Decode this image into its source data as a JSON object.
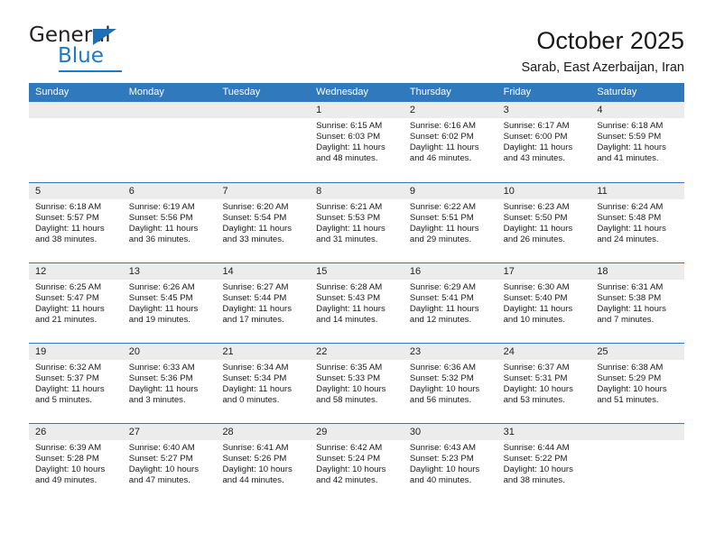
{
  "brand": {
    "name_part1": "General",
    "name_part2": "Blue"
  },
  "header": {
    "title": "October 2025",
    "subtitle": "Sarab, East Azerbaijan, Iran"
  },
  "weekdays": [
    "Sunday",
    "Monday",
    "Tuesday",
    "Wednesday",
    "Thursday",
    "Friday",
    "Saturday"
  ],
  "colors": {
    "header_band": "#3079bd",
    "day_band": "#ececec",
    "brand_blue": "#1f7ac4",
    "text": "#1a1a1a"
  },
  "weeks": [
    [
      {
        "day": "",
        "sunrise": "",
        "sunset": "",
        "daylight1": "",
        "daylight2": ""
      },
      {
        "day": "",
        "sunrise": "",
        "sunset": "",
        "daylight1": "",
        "daylight2": ""
      },
      {
        "day": "",
        "sunrise": "",
        "sunset": "",
        "daylight1": "",
        "daylight2": ""
      },
      {
        "day": "1",
        "sunrise": "Sunrise: 6:15 AM",
        "sunset": "Sunset: 6:03 PM",
        "daylight1": "Daylight: 11 hours",
        "daylight2": "and 48 minutes."
      },
      {
        "day": "2",
        "sunrise": "Sunrise: 6:16 AM",
        "sunset": "Sunset: 6:02 PM",
        "daylight1": "Daylight: 11 hours",
        "daylight2": "and 46 minutes."
      },
      {
        "day": "3",
        "sunrise": "Sunrise: 6:17 AM",
        "sunset": "Sunset: 6:00 PM",
        "daylight1": "Daylight: 11 hours",
        "daylight2": "and 43 minutes."
      },
      {
        "day": "4",
        "sunrise": "Sunrise: 6:18 AM",
        "sunset": "Sunset: 5:59 PM",
        "daylight1": "Daylight: 11 hours",
        "daylight2": "and 41 minutes."
      }
    ],
    [
      {
        "day": "5",
        "sunrise": "Sunrise: 6:18 AM",
        "sunset": "Sunset: 5:57 PM",
        "daylight1": "Daylight: 11 hours",
        "daylight2": "and 38 minutes."
      },
      {
        "day": "6",
        "sunrise": "Sunrise: 6:19 AM",
        "sunset": "Sunset: 5:56 PM",
        "daylight1": "Daylight: 11 hours",
        "daylight2": "and 36 minutes."
      },
      {
        "day": "7",
        "sunrise": "Sunrise: 6:20 AM",
        "sunset": "Sunset: 5:54 PM",
        "daylight1": "Daylight: 11 hours",
        "daylight2": "and 33 minutes."
      },
      {
        "day": "8",
        "sunrise": "Sunrise: 6:21 AM",
        "sunset": "Sunset: 5:53 PM",
        "daylight1": "Daylight: 11 hours",
        "daylight2": "and 31 minutes."
      },
      {
        "day": "9",
        "sunrise": "Sunrise: 6:22 AM",
        "sunset": "Sunset: 5:51 PM",
        "daylight1": "Daylight: 11 hours",
        "daylight2": "and 29 minutes."
      },
      {
        "day": "10",
        "sunrise": "Sunrise: 6:23 AM",
        "sunset": "Sunset: 5:50 PM",
        "daylight1": "Daylight: 11 hours",
        "daylight2": "and 26 minutes."
      },
      {
        "day": "11",
        "sunrise": "Sunrise: 6:24 AM",
        "sunset": "Sunset: 5:48 PM",
        "daylight1": "Daylight: 11 hours",
        "daylight2": "and 24 minutes."
      }
    ],
    [
      {
        "day": "12",
        "sunrise": "Sunrise: 6:25 AM",
        "sunset": "Sunset: 5:47 PM",
        "daylight1": "Daylight: 11 hours",
        "daylight2": "and 21 minutes."
      },
      {
        "day": "13",
        "sunrise": "Sunrise: 6:26 AM",
        "sunset": "Sunset: 5:45 PM",
        "daylight1": "Daylight: 11 hours",
        "daylight2": "and 19 minutes."
      },
      {
        "day": "14",
        "sunrise": "Sunrise: 6:27 AM",
        "sunset": "Sunset: 5:44 PM",
        "daylight1": "Daylight: 11 hours",
        "daylight2": "and 17 minutes."
      },
      {
        "day": "15",
        "sunrise": "Sunrise: 6:28 AM",
        "sunset": "Sunset: 5:43 PM",
        "daylight1": "Daylight: 11 hours",
        "daylight2": "and 14 minutes."
      },
      {
        "day": "16",
        "sunrise": "Sunrise: 6:29 AM",
        "sunset": "Sunset: 5:41 PM",
        "daylight1": "Daylight: 11 hours",
        "daylight2": "and 12 minutes."
      },
      {
        "day": "17",
        "sunrise": "Sunrise: 6:30 AM",
        "sunset": "Sunset: 5:40 PM",
        "daylight1": "Daylight: 11 hours",
        "daylight2": "and 10 minutes."
      },
      {
        "day": "18",
        "sunrise": "Sunrise: 6:31 AM",
        "sunset": "Sunset: 5:38 PM",
        "daylight1": "Daylight: 11 hours",
        "daylight2": "and 7 minutes."
      }
    ],
    [
      {
        "day": "19",
        "sunrise": "Sunrise: 6:32 AM",
        "sunset": "Sunset: 5:37 PM",
        "daylight1": "Daylight: 11 hours",
        "daylight2": "and 5 minutes."
      },
      {
        "day": "20",
        "sunrise": "Sunrise: 6:33 AM",
        "sunset": "Sunset: 5:36 PM",
        "daylight1": "Daylight: 11 hours",
        "daylight2": "and 3 minutes."
      },
      {
        "day": "21",
        "sunrise": "Sunrise: 6:34 AM",
        "sunset": "Sunset: 5:34 PM",
        "daylight1": "Daylight: 11 hours",
        "daylight2": "and 0 minutes."
      },
      {
        "day": "22",
        "sunrise": "Sunrise: 6:35 AM",
        "sunset": "Sunset: 5:33 PM",
        "daylight1": "Daylight: 10 hours",
        "daylight2": "and 58 minutes."
      },
      {
        "day": "23",
        "sunrise": "Sunrise: 6:36 AM",
        "sunset": "Sunset: 5:32 PM",
        "daylight1": "Daylight: 10 hours",
        "daylight2": "and 56 minutes."
      },
      {
        "day": "24",
        "sunrise": "Sunrise: 6:37 AM",
        "sunset": "Sunset: 5:31 PM",
        "daylight1": "Daylight: 10 hours",
        "daylight2": "and 53 minutes."
      },
      {
        "day": "25",
        "sunrise": "Sunrise: 6:38 AM",
        "sunset": "Sunset: 5:29 PM",
        "daylight1": "Daylight: 10 hours",
        "daylight2": "and 51 minutes."
      }
    ],
    [
      {
        "day": "26",
        "sunrise": "Sunrise: 6:39 AM",
        "sunset": "Sunset: 5:28 PM",
        "daylight1": "Daylight: 10 hours",
        "daylight2": "and 49 minutes."
      },
      {
        "day": "27",
        "sunrise": "Sunrise: 6:40 AM",
        "sunset": "Sunset: 5:27 PM",
        "daylight1": "Daylight: 10 hours",
        "daylight2": "and 47 minutes."
      },
      {
        "day": "28",
        "sunrise": "Sunrise: 6:41 AM",
        "sunset": "Sunset: 5:26 PM",
        "daylight1": "Daylight: 10 hours",
        "daylight2": "and 44 minutes."
      },
      {
        "day": "29",
        "sunrise": "Sunrise: 6:42 AM",
        "sunset": "Sunset: 5:24 PM",
        "daylight1": "Daylight: 10 hours",
        "daylight2": "and 42 minutes."
      },
      {
        "day": "30",
        "sunrise": "Sunrise: 6:43 AM",
        "sunset": "Sunset: 5:23 PM",
        "daylight1": "Daylight: 10 hours",
        "daylight2": "and 40 minutes."
      },
      {
        "day": "31",
        "sunrise": "Sunrise: 6:44 AM",
        "sunset": "Sunset: 5:22 PM",
        "daylight1": "Daylight: 10 hours",
        "daylight2": "and 38 minutes."
      },
      {
        "day": "",
        "sunrise": "",
        "sunset": "",
        "daylight1": "",
        "daylight2": ""
      }
    ]
  ]
}
